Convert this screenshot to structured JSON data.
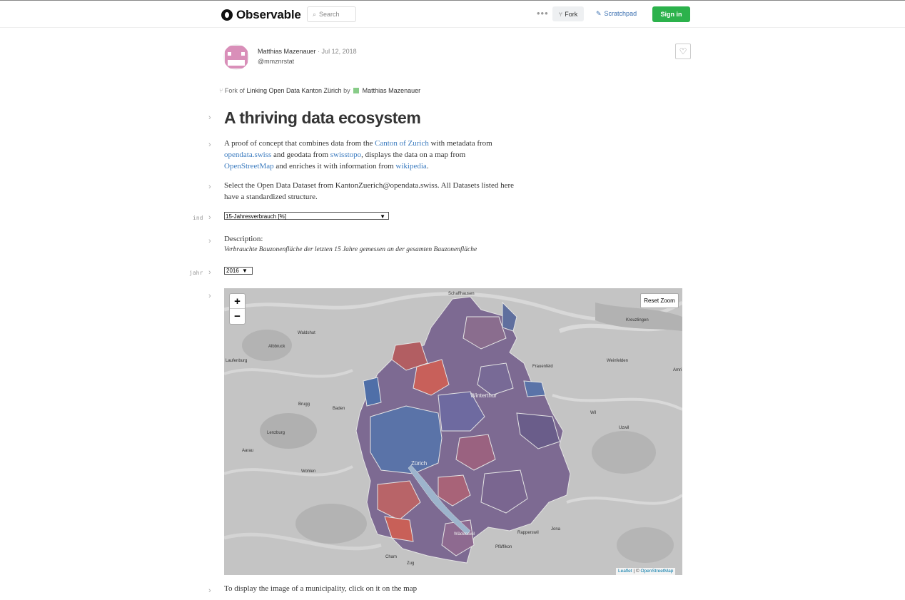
{
  "header": {
    "app_name": "Observable",
    "search_placeholder": "Search",
    "more_label": "•••",
    "fork_label": "Fork",
    "scratchpad_label": "Scratchpad",
    "signin_label": "Sign in"
  },
  "byline": {
    "author": "Matthias Mazenauer",
    "date": "· Jul 12, 2018",
    "handle": "@mmznrstat"
  },
  "fork_note": {
    "prefix": "Fork of",
    "source": "Linking Open Data Kanton Zürich",
    "by": "by",
    "source_author": "Matthias Mazenauer"
  },
  "notebook": {
    "title": "A thriving data ecosystem",
    "intro": {
      "t1": "A proof of concept that combines data from the ",
      "l1": "Canton of Zurich",
      "t2": " with metadata from ",
      "l2": "opendata.swiss",
      "t3": " and geodata from ",
      "l3": "swisstopo",
      "t4": ", displays the data on a map from ",
      "l4": "OpenStreetMap",
      "t5": " and enriches it with information from ",
      "l5": "wikipedia",
      "t6": "."
    },
    "select_text": "Select the Open Data Dataset from KantonZuerich@opendata.swiss. All Datasets listed here have a standardized structure.",
    "var_ind": "ind",
    "dataset_select_value": "15-Jahresverbrauch [%]",
    "description_label": "Description:",
    "description_text": "Verbrauchte Bauzonenfläche der letzten 15 Jahre gemessen an der gesamten Bauzonenfläche",
    "var_jahr": "jahr",
    "year_select_value": "2016",
    "bottom_text": "To display the image of a municipality, click on it on the map"
  },
  "map": {
    "zoom_in": "+",
    "zoom_out": "−",
    "reset_zoom": "Reset Zoom",
    "attribution_leaflet": "Leaflet",
    "attribution_sep": " | © ",
    "attribution_osm": "OpenStreetMap",
    "labels": {
      "schaffhausen": "Schaffhausen",
      "kreuzlingen": "Kreuzlingen",
      "waldshut": "Waldshut",
      "albbruck": "Albbruck",
      "laufenburg": "Laufenburg",
      "frauenfeld": "Frauenfeld",
      "weinfelden": "Weinfelden",
      "amriswil": "Amri",
      "winterthur": "Winterthur",
      "brugg": "Brugg",
      "baden": "Baden",
      "lenzburg": "Lenzburg",
      "aarau": "Aarau",
      "wohlen": "Wohlen",
      "zurich": "Zürich",
      "wil": "Wil",
      "uzwil": "Uzwil",
      "wadenswil": "Wädenswil",
      "cham": "Cham",
      "zug": "Zug",
      "rapperswil": "Rapperswil",
      "jona": "Jona",
      "pfaffikon": "Pfäffikon"
    },
    "colors": {
      "blue": "#5a73a8",
      "red": "#c8605a",
      "purple": "#7d6a92",
      "base": "#bdbdbd"
    }
  }
}
